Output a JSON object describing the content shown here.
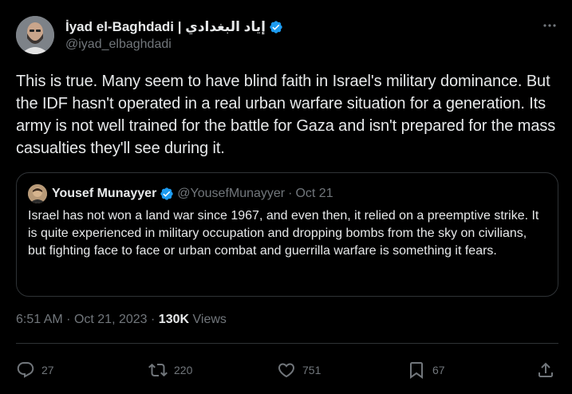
{
  "author": {
    "display_name": "İyad el-Baghdadi | إياد البغدادي",
    "handle": "@iyad_elbaghdadi"
  },
  "tweet": {
    "text": "This is true. Many seem to have blind faith in Israel's military dominance. But the IDF hasn't operated in a real urban warfare situation for a generation. Its army is not well trained for the battle for Gaza and isn't prepared for the mass casualties they'll see during it.",
    "time": "6:51 AM",
    "date": "Oct 21, 2023",
    "views_count": "130K",
    "views_label": "Views"
  },
  "quoted": {
    "display_name": "Yousef Munayyer",
    "handle": "@YousefMunayyer",
    "separator": "·",
    "date": "Oct 21",
    "text": "Israel has not won a land war since 1967, and even then, it relied on a preemptive strike. It is quite experienced in military occupation and dropping bombs from the sky on civilians, but fighting face to face or urban combat and guerrilla warfare is something it fears."
  },
  "meta_separator": "·",
  "actions": {
    "replies": "27",
    "retweets": "220",
    "likes": "751",
    "bookmarks": "67"
  },
  "icons": {
    "verified": "verified-badge-icon",
    "more": "more-horizontal-icon",
    "reply": "reply-icon",
    "retweet": "retweet-icon",
    "like": "heart-icon",
    "bookmark": "bookmark-icon",
    "share": "share-icon"
  },
  "colors": {
    "background": "#000000",
    "text_primary": "#e7e9ea",
    "text_secondary": "#71767b",
    "verified_blue": "#1d9bf0",
    "border": "#2f3336"
  }
}
